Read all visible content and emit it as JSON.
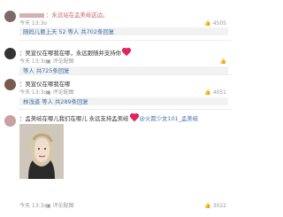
{
  "comments": [
    {
      "body": "：永远站在孟美岐这边。",
      "time": "今天 13:3o",
      "like_count": "4505",
      "reply": {
        "text": "随妈儿要上天 52 等人 共702条回复"
      }
    },
    {
      "body": "：吴宣仪在哪我在哪，永远跟随并支持你",
      "time": "今天 13:3o",
      "like_count": "",
      "reply": {
        "text": "等人 共725条回复"
      },
      "reply_icon_label": "评论配图"
    },
    {
      "body": "：吴宣仪在哪我在哪",
      "time": "今天 13:3o",
      "like_count": "4051",
      "reply_icon_label": "评论配图",
      "reply": {
        "text": "林浅道 等人 共289条回复"
      }
    },
    {
      "body": "：孟美岐在哪儿我们在哪儿 永远支持孟美岐",
      "mention": "@火箭少女101_孟美岐",
      "time": "今天 13:3x",
      "like_count": "3022",
      "reply_icon_label": "评论配图"
    }
  ]
}
